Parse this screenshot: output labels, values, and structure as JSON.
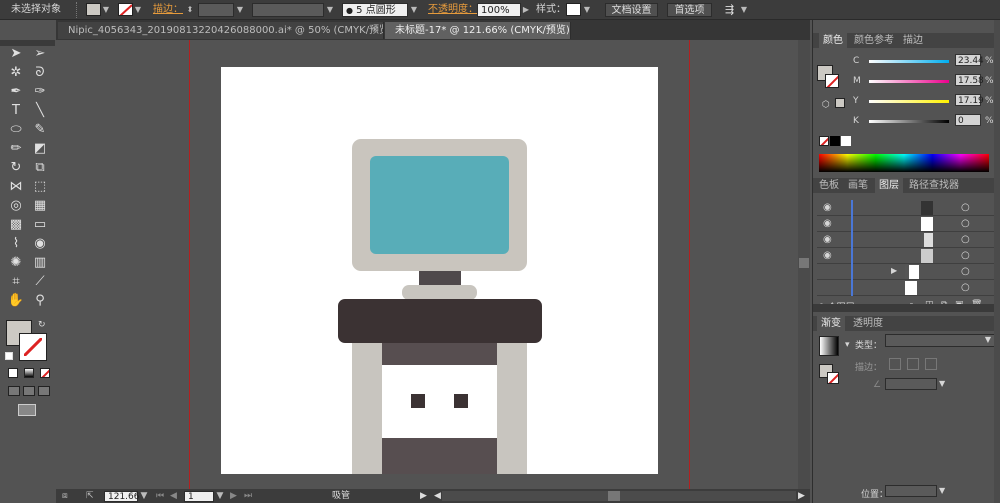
{
  "control_bar": {
    "selection_status": "未选择对象",
    "stroke_label": "描边：",
    "brush_label": "5 点圆形",
    "opacity_label": "不透明度：",
    "opacity_value": "100%",
    "style_label": "样式：",
    "doc_setup_button": "文档设置",
    "preferences_button": "首选项"
  },
  "tabs": [
    {
      "label": "Nipic_4056343_20190813220426088000.ai* @ 50% (CMYK/预览)"
    },
    {
      "label": "未标题-17* @ 121.66% (CMYK/预览)"
    }
  ],
  "tab_close": "×",
  "status_bar": {
    "zoom": "121.66",
    "page": "1",
    "tool_name": "吸管"
  },
  "color_panel": {
    "tabs": [
      "颜色",
      "颜色参考",
      "描边"
    ],
    "channels": [
      {
        "label": "C",
        "value": "23.44"
      },
      {
        "label": "M",
        "value": "17.58"
      },
      {
        "label": "Y",
        "value": "17.19"
      },
      {
        "label": "K",
        "value": "0"
      }
    ],
    "pct": "%"
  },
  "layers_panel": {
    "tabs": [
      "色板",
      "画笔",
      "图层",
      "路径查找器"
    ],
    "footer": "1 个图层"
  },
  "gradient_panel": {
    "tabs": [
      "渐变",
      "透明度"
    ],
    "type_label": "类型：",
    "stroke_label": "描边：",
    "position_label": "位置："
  },
  "colors": {
    "monitor_frame": "#c9c5be",
    "monitor_screen": "#58adb8",
    "monitor_neck": "#4f494b",
    "desk_top": "#3b3233",
    "desk_legs": "#c8c5bf",
    "drawer_band": "#574e50",
    "guide": "#b32020"
  }
}
